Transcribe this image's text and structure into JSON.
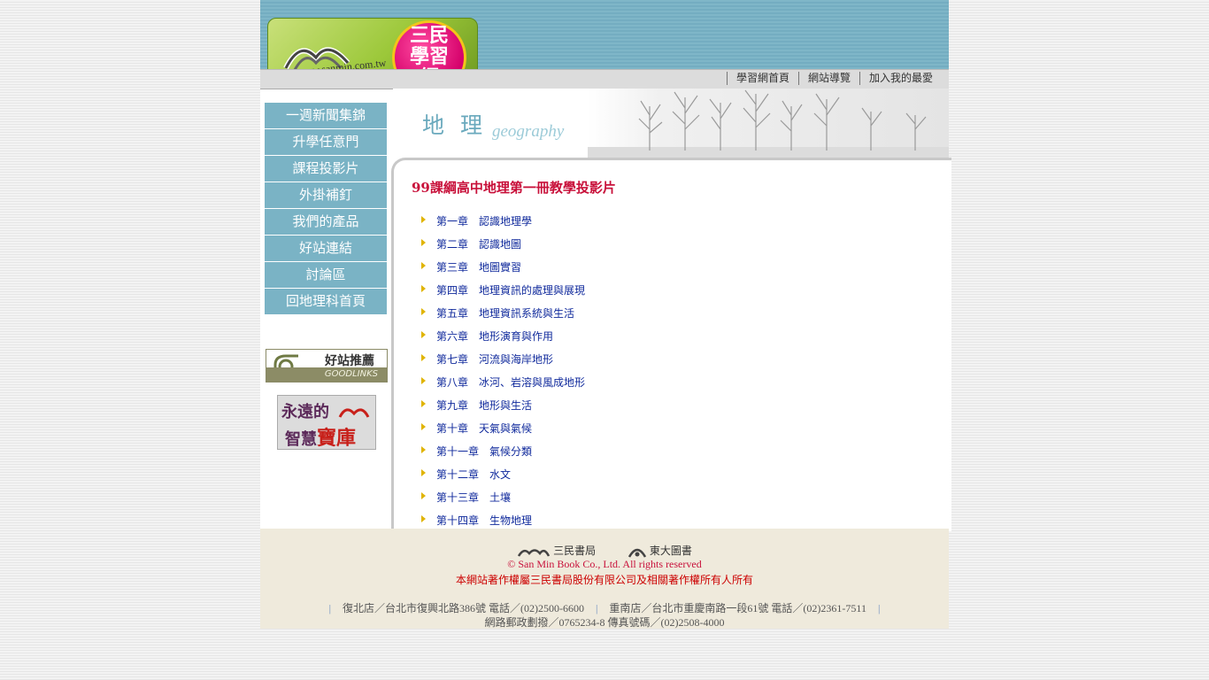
{
  "header": {
    "logo_badge": "三民學習網",
    "logo_url_text": "www.sanmin.com.tw",
    "nav": [
      "學習網首頁",
      "網站導覽",
      "加入我的最愛"
    ]
  },
  "sidebar": {
    "items": [
      "一週新聞集錦",
      "升學任意門",
      "課程投影片",
      "外掛補釘",
      "我們的產品",
      "好站連結",
      "討論區",
      "回地理科首頁"
    ],
    "goodlinks_title": "好站推薦",
    "goodlinks_sub": "GOODLINKS",
    "treasure_line1": "永遠的",
    "treasure_line2a": "智慧",
    "treasure_line2b": "寶庫"
  },
  "banner": {
    "title": "地理",
    "subtitle": "geography"
  },
  "content": {
    "title": "99課綱高中地理第一冊教學投影片",
    "chapters": [
      "第一章　認識地理學",
      "第二章　認識地圖",
      "第三章　地圖實習",
      "第四章　地理資訊的處理與展現",
      "第五章　地理資訊系統與生活",
      "第六章　地形演育與作用",
      "第七章　河流與海岸地形",
      "第八章　冰河、岩溶與風成地形",
      "第九章　地形與生活",
      "第十章　天氣與氣候",
      "第十一章　氣候分類",
      "第十二章　水文",
      "第十三章　土壤",
      "第十四章　生物地理"
    ]
  },
  "footer": {
    "brand1": "三民書局",
    "brand2": "東大圖書",
    "copyright": "© San Min Book Co., Ltd. All rights reserved",
    "rights": "本網站著作權屬三民書局股份有限公司及相關著作權所有人所有",
    "store1": "復北店／台北市復興北路386號 電話／(02)2500-6600",
    "store2": "重南店／台北市重慶南路一段61號 電話／(02)2361-7511",
    "postal": "網路郵政劃撥／0765234-8 傳真號碼／(02)2508-4000"
  }
}
